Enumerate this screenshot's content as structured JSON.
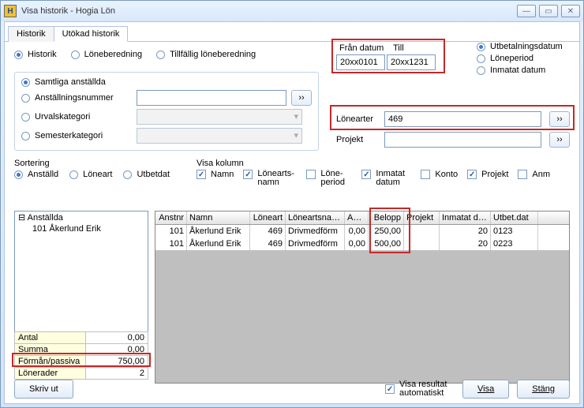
{
  "window": {
    "title": "Visa historik - Hogia Lön",
    "icon": "H"
  },
  "tabs": [
    {
      "label": "Historik",
      "active": false
    },
    {
      "label": "Utökad historik",
      "active": true
    }
  ],
  "topRadios": {
    "historik": "Historik",
    "lonebered": "Löneberedning",
    "tillfallig": "Tillfällig löneberedning"
  },
  "dateBox": {
    "from_label": "Från datum",
    "to_label": "Till",
    "from_value": "20xx0101",
    "to_value": "20xx1231"
  },
  "rightRadios": {
    "utbet": "Utbetalningsdatum",
    "loneperiod": "Löneperiod",
    "inmatat": "Inmatat datum"
  },
  "scope": {
    "samtliga": "Samtliga anställda",
    "anstnr": "Anställningsnummer",
    "urval": "Urvalskategori",
    "semester": "Semesterkategori"
  },
  "filters": {
    "lonearter_label": "Lönearter",
    "lonearter_value": "469",
    "projekt_label": "Projekt",
    "projekt_value": ""
  },
  "sorting": {
    "group": "Sortering",
    "anstalld": "Anställd",
    "loneart": "Löneart",
    "utbetdat": "Utbetdat"
  },
  "columns": {
    "group": "Visa kolumn",
    "namn": "Namn",
    "loneartsnamn": "Lönearts- namn",
    "loneperiod": "Löne- period",
    "inmatat": "Inmatat datum",
    "konto": "Konto",
    "projekt": "Projekt",
    "anm": "Anm"
  },
  "tree": {
    "root": "Anställda",
    "item": "101 Åkerlund Erik"
  },
  "summary": [
    {
      "label": "Antal",
      "value": "0,00"
    },
    {
      "label": "Summa",
      "value": "0,00"
    },
    {
      "label": "Förmån/passiva",
      "value": "750,00"
    },
    {
      "label": "Lönerader",
      "value": "2"
    }
  ],
  "grid": {
    "headers": [
      "Anstnr",
      "Namn",
      "Löneart",
      "Löneartsnamn",
      "Antal",
      "Belopp",
      "Projekt",
      "Inmatat datum",
      "Utbet.dat"
    ],
    "rows": [
      {
        "anstnr": "101",
        "namn": "Åkerlund Erik",
        "loneart": "469",
        "lonenamn": "Drivmedförm",
        "antal": "0,00",
        "belopp": "250,00",
        "projekt": "",
        "inmat": "20",
        "utbet": "0123"
      },
      {
        "anstnr": "101",
        "namn": "Åkerlund Erik",
        "loneart": "469",
        "lonenamn": "Drivmedförm",
        "antal": "0,00",
        "belopp": "500,00",
        "projekt": "",
        "inmat": "20",
        "utbet": "0223"
      }
    ]
  },
  "footer": {
    "print": "Skriv ut",
    "auto": "Visa resultat automatiskt",
    "visa": "Visa",
    "stang": "Stäng"
  }
}
